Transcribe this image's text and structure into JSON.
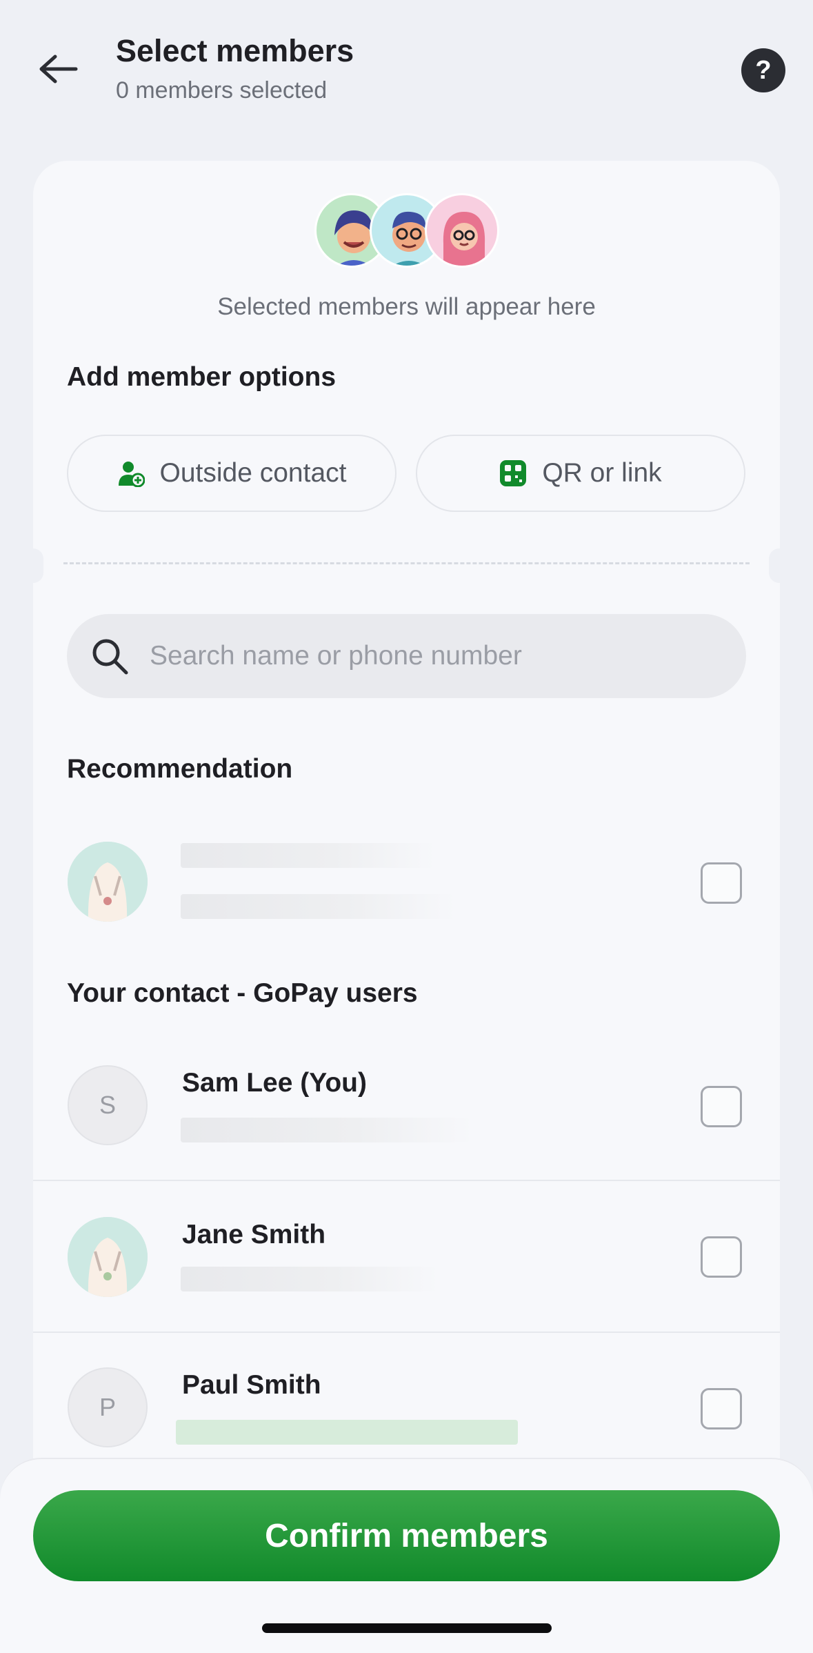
{
  "header": {
    "title": "Select members",
    "subtitle": "0 members selected",
    "back_icon": "arrow-left-icon",
    "help_label": "?"
  },
  "selected_area": {
    "hint": "Selected members will appear here"
  },
  "add_options": {
    "title": "Add member options",
    "outside_contact": "Outside contact",
    "qr_or_link": "QR or link",
    "accent_color": "#118a2b"
  },
  "search": {
    "placeholder": "Search name or phone number"
  },
  "recommendation": {
    "title": "Recommendation"
  },
  "contacts": {
    "title": "Your contact - GoPay users",
    "items": [
      {
        "initial": "S",
        "name": "Sam Lee (You)"
      },
      {
        "initial": "",
        "name": "Jane Smith"
      },
      {
        "initial": "P",
        "name": "Paul Smith"
      }
    ]
  },
  "footer": {
    "confirm_label": "Confirm members",
    "button_color": "#118a2b"
  }
}
